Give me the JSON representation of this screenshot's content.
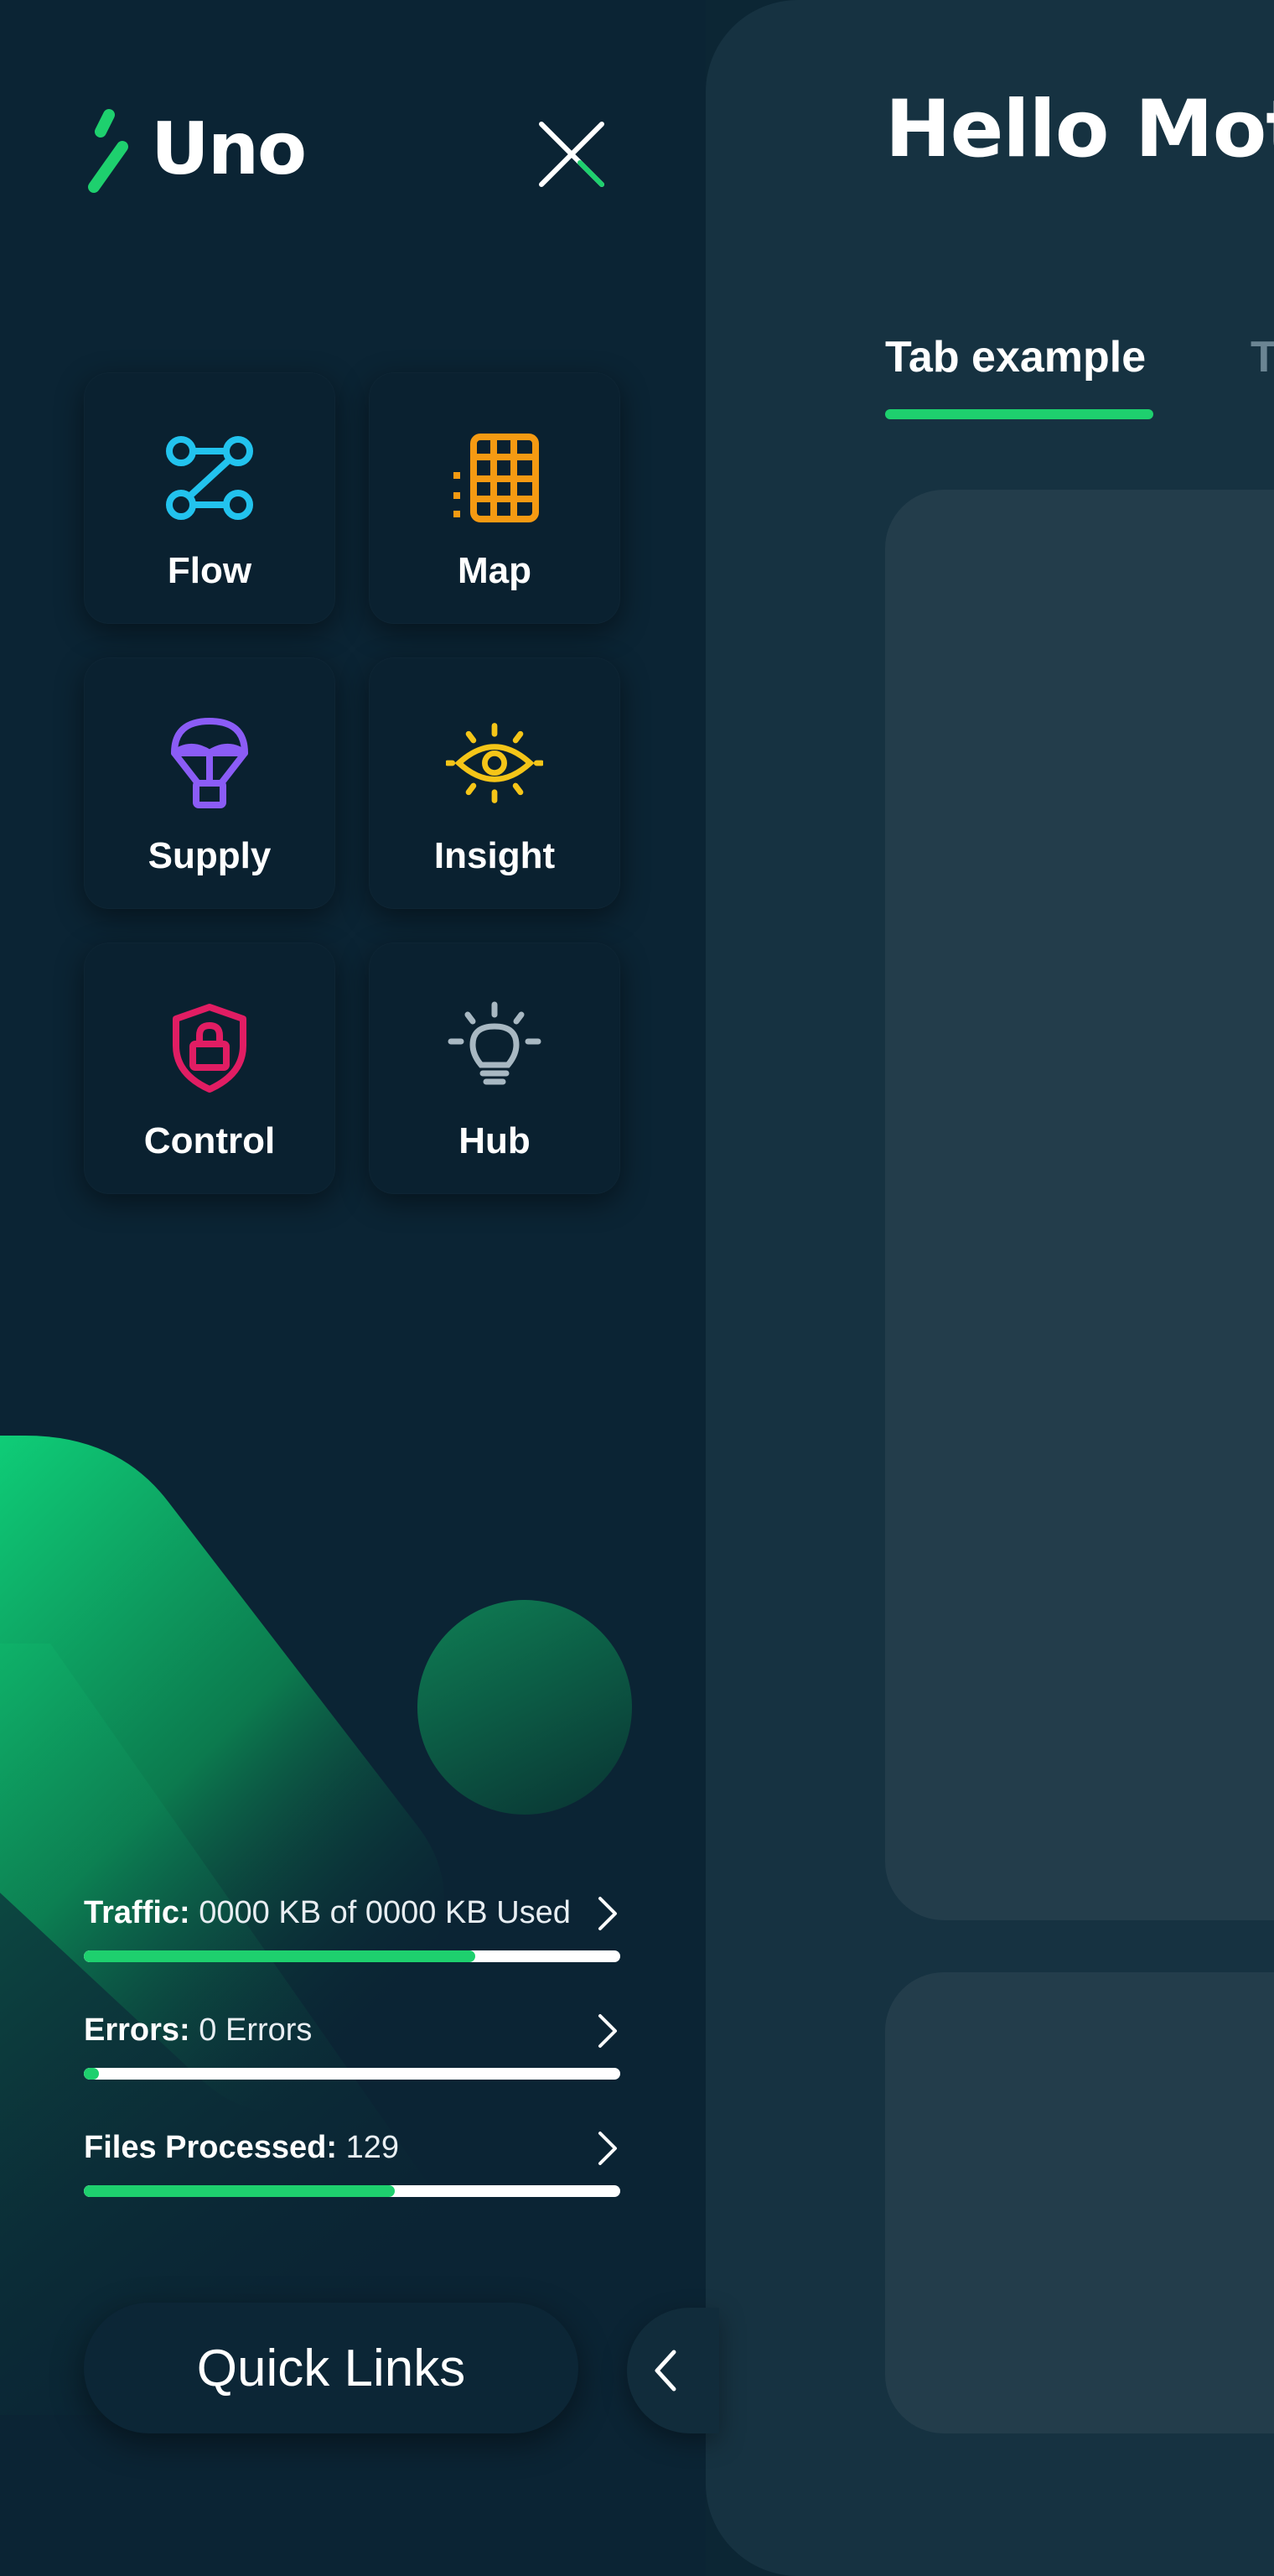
{
  "app": {
    "name": "Uno",
    "accent_color": "#1ed06e"
  },
  "sidebar": {
    "close_icon": "close-icon",
    "tiles": [
      {
        "label": "Flow",
        "icon": "flow-nodes-icon",
        "color": "#22c3ee"
      },
      {
        "label": "Map",
        "icon": "map-grid-icon",
        "color": "#f59a12"
      },
      {
        "label": "Supply",
        "icon": "parachute-icon",
        "color": "#8b5cf6"
      },
      {
        "label": "Insight",
        "icon": "eye-icon",
        "color": "#f5c518"
      },
      {
        "label": "Control",
        "icon": "shield-lock-icon",
        "color": "#e11d63"
      },
      {
        "label": "Hub",
        "icon": "lightbulb-icon",
        "color": "#a8b8c2"
      }
    ],
    "stats": [
      {
        "label": "Traffic:",
        "value": "0000 KB of 0000 KB Used",
        "progress": 0.73
      },
      {
        "label": "Errors:",
        "value": "0 Errors",
        "progress": 0.03
      },
      {
        "label": "Files Processed:",
        "value": "129",
        "progress": 0.58
      }
    ],
    "quick_links_label": "Quick Links"
  },
  "main": {
    "greeting": "Hello Mot",
    "tabs": [
      {
        "label": "Tab example",
        "active": true
      },
      {
        "label": "T",
        "active": false
      }
    ]
  }
}
